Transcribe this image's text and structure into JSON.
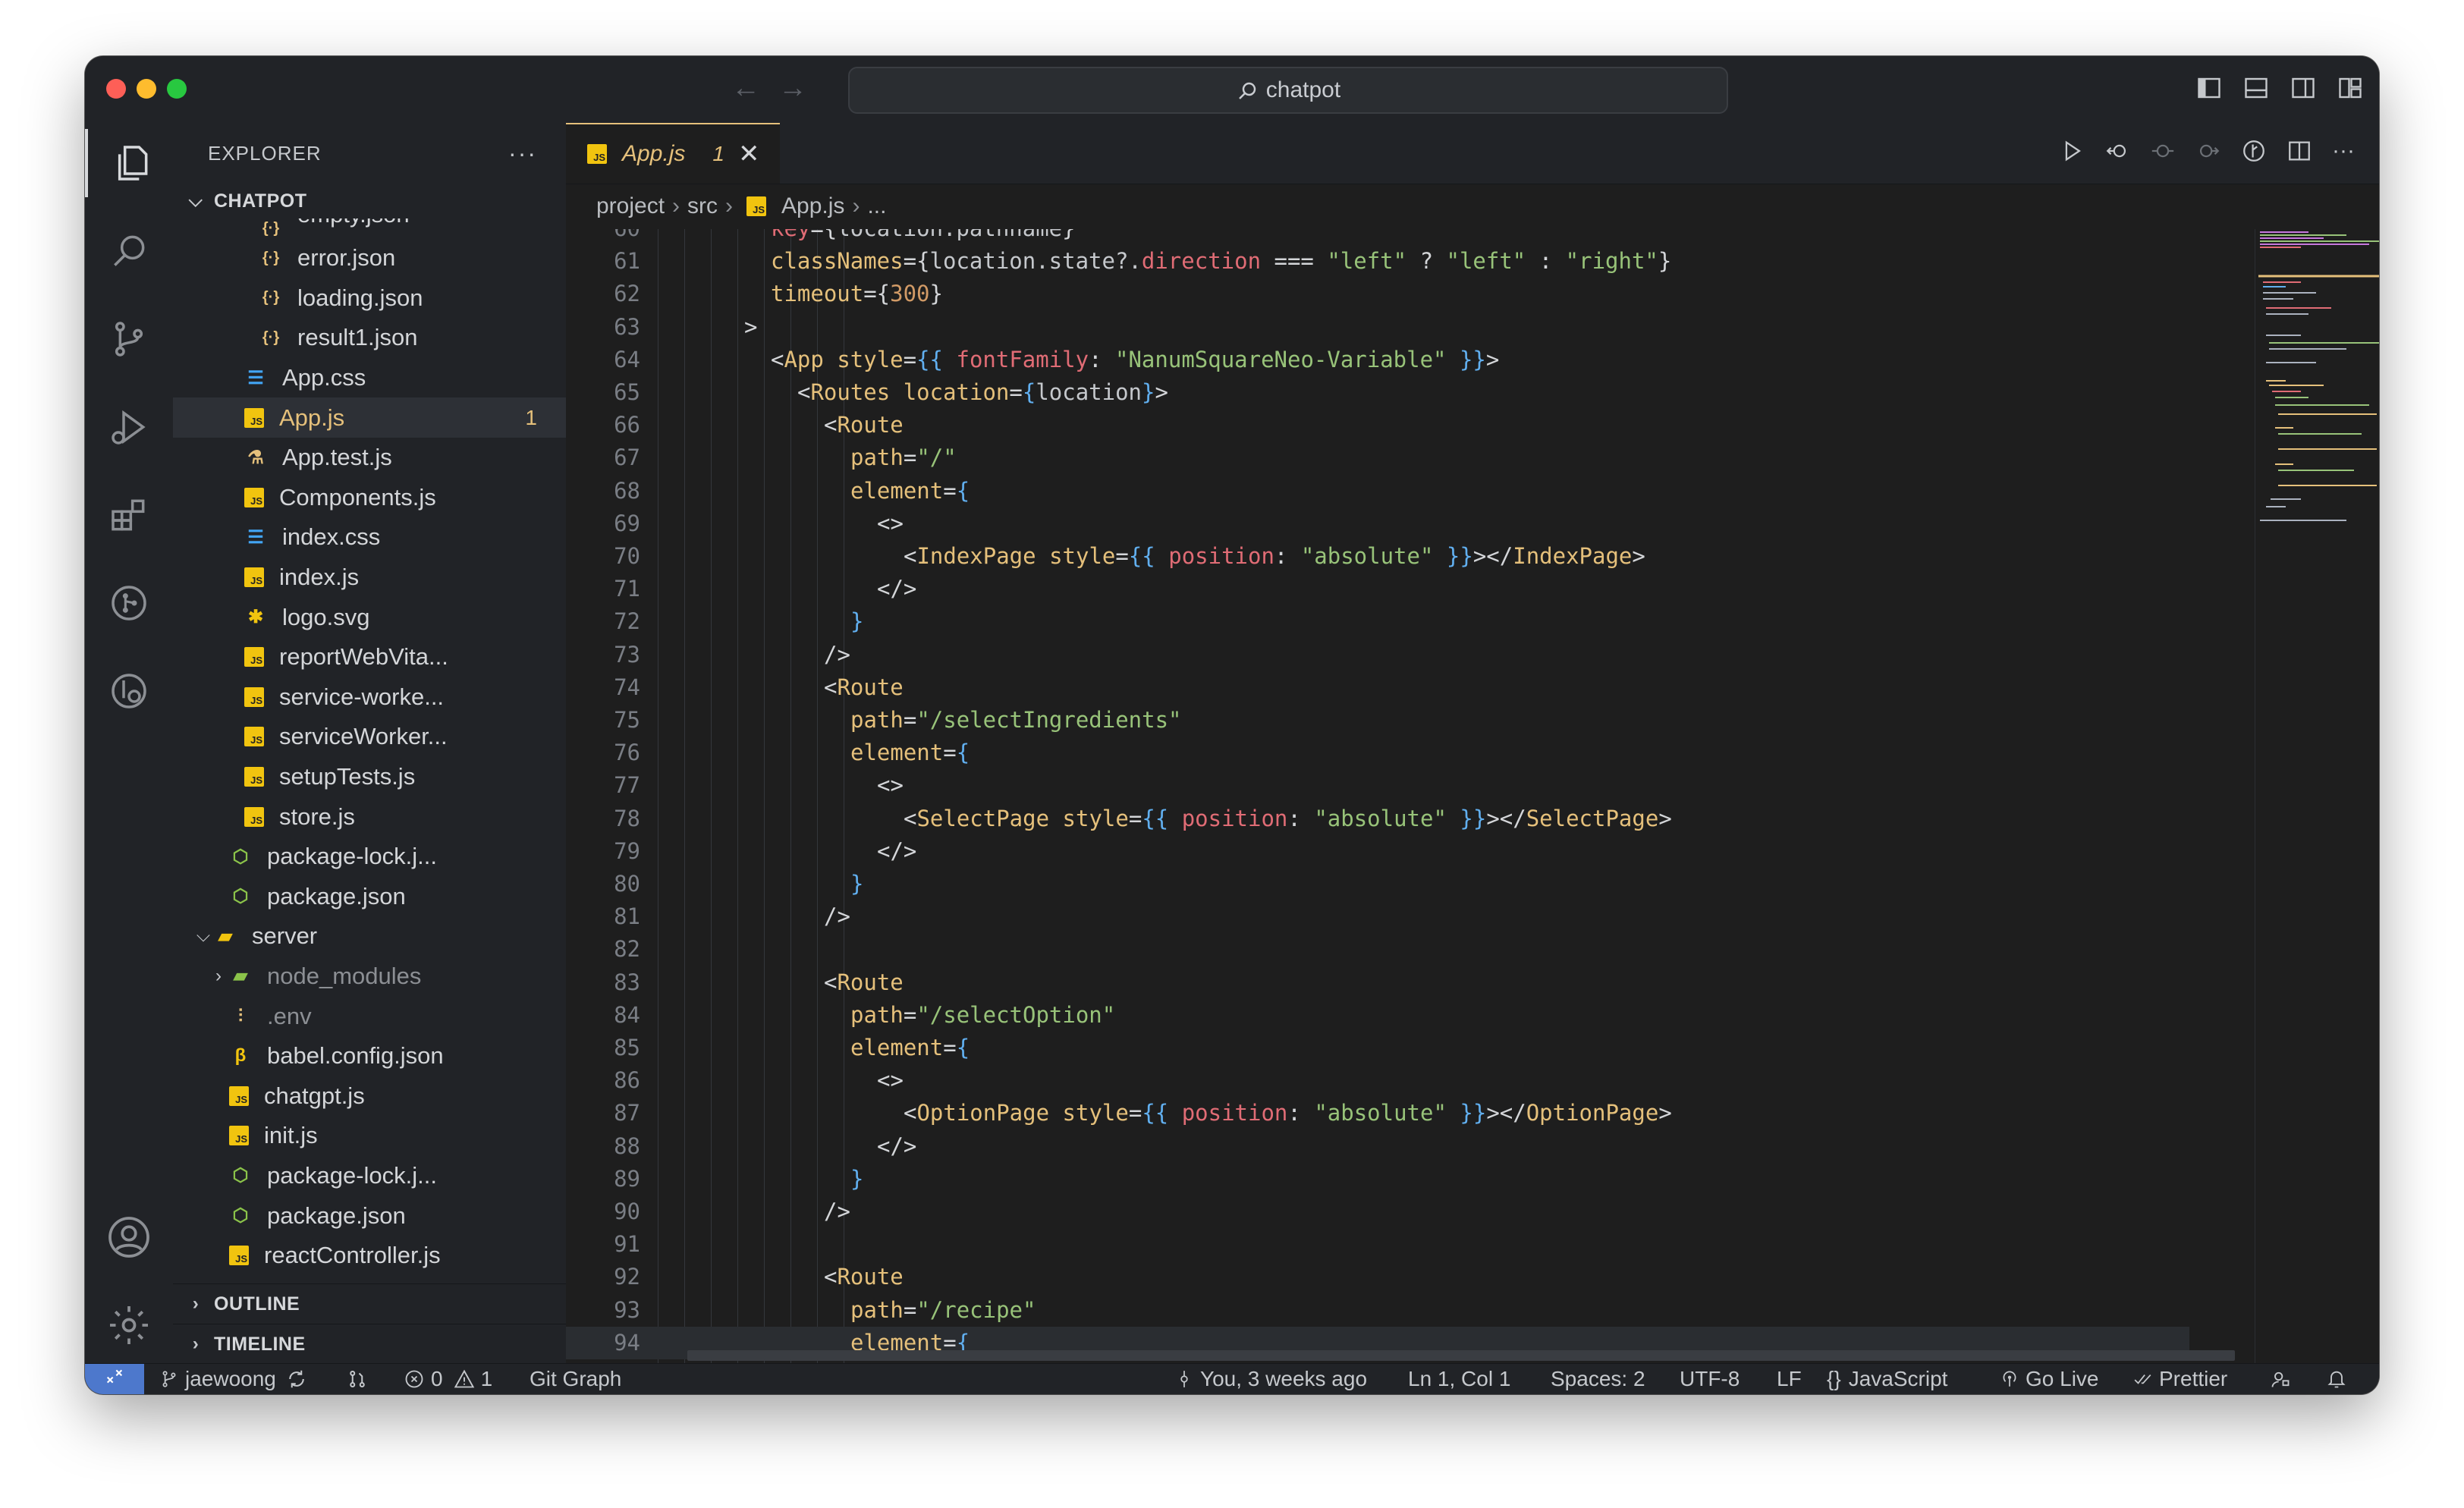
{
  "window": {
    "search_text": "chatpot"
  },
  "sidebar": {
    "title": "EXPLORER",
    "more": "···",
    "project_section": "CHATPOT",
    "files": [
      {
        "name": "empty.json",
        "icon": "json",
        "indent": 3,
        "partial": true
      },
      {
        "name": "error.json",
        "icon": "json",
        "indent": 3
      },
      {
        "name": "loading.json",
        "icon": "json",
        "indent": 3
      },
      {
        "name": "result1.json",
        "icon": "json",
        "indent": 3
      },
      {
        "name": "App.css",
        "icon": "css",
        "indent": 2
      },
      {
        "name": "App.js",
        "icon": "js",
        "indent": 2,
        "selected": true,
        "badge": "1"
      },
      {
        "name": "App.test.js",
        "icon": "test",
        "indent": 2
      },
      {
        "name": "Components.js",
        "icon": "js",
        "indent": 2
      },
      {
        "name": "index.css",
        "icon": "css",
        "indent": 2
      },
      {
        "name": "index.js",
        "icon": "js",
        "indent": 2
      },
      {
        "name": "logo.svg",
        "icon": "svg",
        "indent": 2
      },
      {
        "name": "reportWebVita...",
        "icon": "js",
        "indent": 2
      },
      {
        "name": "service-worke...",
        "icon": "js",
        "indent": 2
      },
      {
        "name": "serviceWorker...",
        "icon": "js",
        "indent": 2
      },
      {
        "name": "setupTests.js",
        "icon": "js",
        "indent": 2
      },
      {
        "name": "store.js",
        "icon": "js",
        "indent": 2
      },
      {
        "name": "package-lock.j...",
        "icon": "node",
        "indent": 1
      },
      {
        "name": "package.json",
        "icon": "node",
        "indent": 1
      },
      {
        "name": "server",
        "icon": "folder-open",
        "indent": 0,
        "chevron": "open"
      },
      {
        "name": "node_modules",
        "icon": "folder-node",
        "indent": 1,
        "chevron": "closed",
        "dim": true
      },
      {
        "name": ".env",
        "icon": "env",
        "indent": 1,
        "dim": true
      },
      {
        "name": "babel.config.json",
        "icon": "babel",
        "indent": 1
      },
      {
        "name": "chatgpt.js",
        "icon": "js",
        "indent": 1
      },
      {
        "name": "init.js",
        "icon": "js",
        "indent": 1
      },
      {
        "name": "package-lock.j...",
        "icon": "node",
        "indent": 1
      },
      {
        "name": "package.json",
        "icon": "node",
        "indent": 1
      },
      {
        "name": "reactController.js",
        "icon": "js",
        "indent": 1
      }
    ],
    "outline": "OUTLINE",
    "timeline": "TIMELINE"
  },
  "editor": {
    "tab": {
      "label": "App.js",
      "problems": "1"
    },
    "breadcrumb": [
      "project",
      "src",
      "App.js",
      "..."
    ],
    "lines": [
      {
        "n": "60",
        "indent": 4,
        "tokens": [
          [
            "key",
            "key"
          ],
          [
            "pun",
            "={"
          ],
          [
            "var",
            "location.pathname"
          ],
          [
            "pun",
            "}"
          ]
        ]
      },
      {
        "n": "61",
        "indent": 4,
        "tokens": [
          [
            "attr",
            "classNames"
          ],
          [
            "pun",
            "={"
          ],
          [
            "var",
            "location.state?."
          ],
          [
            "key",
            "direction"
          ],
          [
            "op",
            " === "
          ],
          [
            "str",
            "\"left\""
          ],
          [
            "op",
            " ? "
          ],
          [
            "str",
            "\"left\""
          ],
          [
            "op",
            " : "
          ],
          [
            "str",
            "\"right\""
          ],
          [
            "pun",
            "}"
          ]
        ]
      },
      {
        "n": "62",
        "indent": 4,
        "tokens": [
          [
            "attr",
            "timeout"
          ],
          [
            "pun",
            "={"
          ],
          [
            "num",
            "300"
          ],
          [
            "pun",
            "}"
          ]
        ]
      },
      {
        "n": "63",
        "indent": 3,
        "tokens": [
          [
            "pun",
            ">"
          ]
        ]
      },
      {
        "n": "64",
        "indent": 4,
        "tokens": [
          [
            "pun",
            "<"
          ],
          [
            "tag",
            "App"
          ],
          [
            "attr",
            " style"
          ],
          [
            "pun",
            "="
          ],
          [
            "br",
            "{{ "
          ],
          [
            "key",
            "fontFamily"
          ],
          [
            "pun",
            ": "
          ],
          [
            "str",
            "\"NanumSquareNeo-Variable\""
          ],
          [
            "br",
            " }}"
          ],
          [
            "pun",
            ">"
          ]
        ]
      },
      {
        "n": "65",
        "indent": 5,
        "tokens": [
          [
            "pun",
            "<"
          ],
          [
            "tag",
            "Routes"
          ],
          [
            "attr",
            " location"
          ],
          [
            "pun",
            "="
          ],
          [
            "br",
            "{"
          ],
          [
            "var",
            "location"
          ],
          [
            "br",
            "}"
          ],
          [
            "pun",
            ">"
          ]
        ]
      },
      {
        "n": "66",
        "indent": 6,
        "tokens": [
          [
            "pun",
            "<"
          ],
          [
            "tag",
            "Route"
          ]
        ]
      },
      {
        "n": "67",
        "indent": 7,
        "tokens": [
          [
            "attr",
            "path"
          ],
          [
            "pun",
            "="
          ],
          [
            "str",
            "\"/\""
          ]
        ]
      },
      {
        "n": "68",
        "indent": 7,
        "tokens": [
          [
            "attr",
            "element"
          ],
          [
            "pun",
            "="
          ],
          [
            "br",
            "{"
          ]
        ]
      },
      {
        "n": "69",
        "indent": 8,
        "tokens": [
          [
            "pun",
            "<>"
          ]
        ]
      },
      {
        "n": "70",
        "indent": 9,
        "tokens": [
          [
            "pun",
            "<"
          ],
          [
            "tag",
            "IndexPage"
          ],
          [
            "attr",
            " style"
          ],
          [
            "pun",
            "="
          ],
          [
            "br",
            "{{ "
          ],
          [
            "key",
            "position"
          ],
          [
            "pun",
            ": "
          ],
          [
            "str",
            "\"absolute\""
          ],
          [
            "br",
            " }}"
          ],
          [
            "pun",
            "></"
          ],
          [
            "tag",
            "IndexPage"
          ],
          [
            "pun",
            ">"
          ]
        ]
      },
      {
        "n": "71",
        "indent": 8,
        "tokens": [
          [
            "pun",
            "</>"
          ]
        ]
      },
      {
        "n": "72",
        "indent": 7,
        "tokens": [
          [
            "br",
            "}"
          ]
        ]
      },
      {
        "n": "73",
        "indent": 6,
        "tokens": [
          [
            "pun",
            "/>"
          ]
        ]
      },
      {
        "n": "74",
        "indent": 6,
        "tokens": [
          [
            "pun",
            "<"
          ],
          [
            "tag",
            "Route"
          ]
        ]
      },
      {
        "n": "75",
        "indent": 7,
        "tokens": [
          [
            "attr",
            "path"
          ],
          [
            "pun",
            "="
          ],
          [
            "str",
            "\"/selectIngredients\""
          ]
        ]
      },
      {
        "n": "76",
        "indent": 7,
        "tokens": [
          [
            "attr",
            "element"
          ],
          [
            "pun",
            "="
          ],
          [
            "br",
            "{"
          ]
        ]
      },
      {
        "n": "77",
        "indent": 8,
        "tokens": [
          [
            "pun",
            "<>"
          ]
        ]
      },
      {
        "n": "78",
        "indent": 9,
        "tokens": [
          [
            "pun",
            "<"
          ],
          [
            "tag",
            "SelectPage"
          ],
          [
            "attr",
            " style"
          ],
          [
            "pun",
            "="
          ],
          [
            "br",
            "{{ "
          ],
          [
            "key",
            "position"
          ],
          [
            "pun",
            ": "
          ],
          [
            "str",
            "\"absolute\""
          ],
          [
            "br",
            " }}"
          ],
          [
            "pun",
            "></"
          ],
          [
            "tag",
            "SelectPage"
          ],
          [
            "pun",
            ">"
          ]
        ]
      },
      {
        "n": "79",
        "indent": 8,
        "tokens": [
          [
            "pun",
            "</>"
          ]
        ]
      },
      {
        "n": "80",
        "indent": 7,
        "tokens": [
          [
            "br",
            "}"
          ]
        ]
      },
      {
        "n": "81",
        "indent": 6,
        "tokens": [
          [
            "pun",
            "/>"
          ]
        ]
      },
      {
        "n": "82",
        "indent": 0,
        "tokens": []
      },
      {
        "n": "83",
        "indent": 6,
        "tokens": [
          [
            "pun",
            "<"
          ],
          [
            "tag",
            "Route"
          ]
        ]
      },
      {
        "n": "84",
        "indent": 7,
        "tokens": [
          [
            "attr",
            "path"
          ],
          [
            "pun",
            "="
          ],
          [
            "str",
            "\"/selectOption\""
          ]
        ]
      },
      {
        "n": "85",
        "indent": 7,
        "tokens": [
          [
            "attr",
            "element"
          ],
          [
            "pun",
            "="
          ],
          [
            "br",
            "{"
          ]
        ]
      },
      {
        "n": "86",
        "indent": 8,
        "tokens": [
          [
            "pun",
            "<>"
          ]
        ]
      },
      {
        "n": "87",
        "indent": 9,
        "tokens": [
          [
            "pun",
            "<"
          ],
          [
            "tag",
            "OptionPage"
          ],
          [
            "attr",
            " style"
          ],
          [
            "pun",
            "="
          ],
          [
            "br",
            "{{ "
          ],
          [
            "key",
            "position"
          ],
          [
            "pun",
            ": "
          ],
          [
            "str",
            "\"absolute\""
          ],
          [
            "br",
            " }}"
          ],
          [
            "pun",
            "></"
          ],
          [
            "tag",
            "OptionPage"
          ],
          [
            "pun",
            ">"
          ]
        ]
      },
      {
        "n": "88",
        "indent": 8,
        "tokens": [
          [
            "pun",
            "</>"
          ]
        ]
      },
      {
        "n": "89",
        "indent": 7,
        "tokens": [
          [
            "br",
            "}"
          ]
        ]
      },
      {
        "n": "90",
        "indent": 6,
        "tokens": [
          [
            "pun",
            "/>"
          ]
        ]
      },
      {
        "n": "91",
        "indent": 0,
        "tokens": []
      },
      {
        "n": "92",
        "indent": 6,
        "tokens": [
          [
            "pun",
            "<"
          ],
          [
            "tag",
            "Route"
          ]
        ]
      },
      {
        "n": "93",
        "indent": 7,
        "tokens": [
          [
            "attr",
            "path"
          ],
          [
            "pun",
            "="
          ],
          [
            "str",
            "\"/recipe\""
          ]
        ]
      },
      {
        "n": "94",
        "indent": 7,
        "tokens": [
          [
            "attr",
            "element"
          ],
          [
            "pun",
            "="
          ],
          [
            "br",
            "{"
          ]
        ]
      }
    ]
  },
  "statusbar": {
    "branch": "jaewoong",
    "errors": "0",
    "warnings": "1",
    "git_graph": "Git Graph",
    "blame": "You, 3 weeks ago",
    "position": "Ln 1, Col 1",
    "spaces": "Spaces: 2",
    "encoding": "UTF-8",
    "eol": "LF",
    "language": "JavaScript",
    "golive": "Go Live",
    "prettier": "Prettier"
  },
  "colors": {
    "accent": "#e5c07b",
    "string": "#98c379",
    "property": "#e06c75",
    "bracket": "#61afef",
    "number": "#d19a66",
    "remote": "#4d78cc"
  }
}
